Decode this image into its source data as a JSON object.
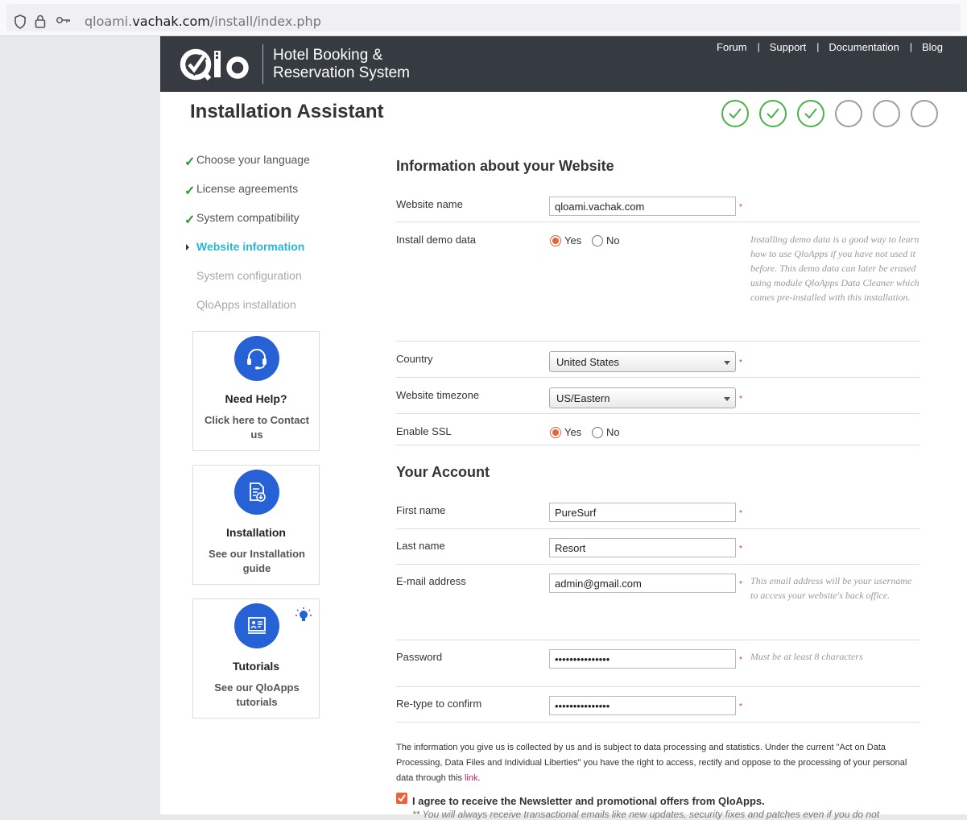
{
  "browser": {
    "url_prefix": "qloami.",
    "url_domain": "vachak.com",
    "url_path": "/install/index.php"
  },
  "header": {
    "logo_text": "Qlo",
    "title_line1": "Hotel Booking &",
    "title_line2": "Reservation System",
    "nav": [
      "Forum",
      "Support",
      "Documentation",
      "Blog"
    ]
  },
  "page_title": "Installation Assistant",
  "progress": {
    "total_steps": 6,
    "completed_steps": 3
  },
  "sidebar": {
    "steps": [
      {
        "label": "Choose your language",
        "state": "done"
      },
      {
        "label": "License agreements",
        "state": "done"
      },
      {
        "label": "System compatibility",
        "state": "done"
      },
      {
        "label": "Website information",
        "state": "active"
      },
      {
        "label": "System configuration",
        "state": "todo"
      },
      {
        "label": "QloApps installation",
        "state": "todo"
      }
    ],
    "cards": [
      {
        "title": "Need Help?",
        "subtitle": "Click here to Contact us",
        "icon": "headset-icon"
      },
      {
        "title": "Installation",
        "subtitle": "See our Installation guide",
        "icon": "document-download-icon"
      },
      {
        "title": "Tutorials",
        "subtitle": "See our QloApps tutorials",
        "icon": "presentation-icon"
      }
    ]
  },
  "website_section": {
    "title": "Information about your Website",
    "website_name_label": "Website name",
    "website_name_value": "qloami.vachak.com",
    "demo_label": "Install demo data",
    "demo_yes": "Yes",
    "demo_no": "No",
    "demo_selected": "Yes",
    "demo_hint": "Installing demo data is a good way to learn how to use QloApps if you have not used it before. This demo data can later be erased using module QloApps Data Cleaner which comes pre-installed with this installation.",
    "country_label": "Country",
    "country_value": "United States",
    "timezone_label": "Website timezone",
    "timezone_value": "US/Eastern",
    "ssl_label": "Enable SSL",
    "ssl_yes": "Yes",
    "ssl_no": "No",
    "ssl_selected": "Yes"
  },
  "account_section": {
    "title": "Your Account",
    "first_name_label": "First name",
    "first_name_value": "PureSurf",
    "last_name_label": "Last name",
    "last_name_value": "Resort",
    "email_label": "E-mail address",
    "email_value": "admin@gmail.com",
    "email_hint": "This email address will be your username to access your website's back office.",
    "password_label": "Password",
    "password_value": "•••••••••••••••",
    "password_hint": "Must be at least 8 characters",
    "confirm_label": "Re-type to confirm",
    "confirm_value": "•••••••••••••••"
  },
  "legal": {
    "text": "The information you give us is collected by us and is subject to data processing and statistics. Under the current \"Act on Data Processing, Data Files and Individual Liberties\" you have the right to access, rectify and oppose to the processing of your personal data through this ",
    "link": "link",
    "end": "."
  },
  "newsletter": {
    "checked": true,
    "label": "I agree to receive the Newsletter and promotional offers from QloApps.",
    "note": "** You will always receive transactional emails like new updates, security fixes and patches even if you do not"
  },
  "colors": {
    "header_bg": "#363a41",
    "accent_active": "#25b9d7",
    "radio_accent": "#e8643a",
    "step_done": "#4cb04c",
    "card_icon_bg": "#2662d6"
  }
}
